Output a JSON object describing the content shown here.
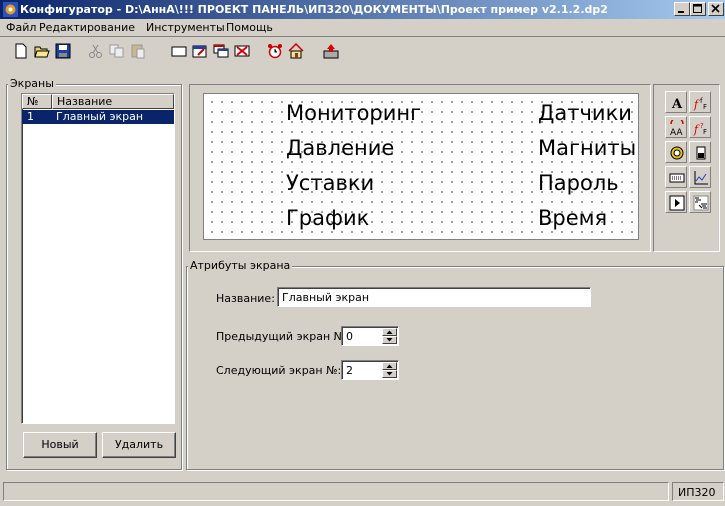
{
  "window": {
    "title": "Конфигуратор - D:\\АннА\\!!! ПРОЕКТ ПАНЕЛЬ\\ИП320\\ДОКУМЕНТЫ\\Проект пример v2.1.2.dp2"
  },
  "menu": [
    "Файл",
    "Редактирование",
    "Инструменты",
    "Помощь"
  ],
  "screens_panel": {
    "legend": "Экраны",
    "columns": [
      "№",
      "Название"
    ],
    "rows": [
      {
        "num": "1",
        "name": "Главный экран"
      }
    ],
    "new_button": "Новый",
    "delete_button": "Удалить"
  },
  "canvas": {
    "rows": [
      {
        "left": "Мониторинг",
        "right": "Датчики"
      },
      {
        "left": "Давление",
        "right": "Магниты"
      },
      {
        "left": "Уставки",
        "right": "Пароль"
      },
      {
        "left": "График",
        "right": "Время"
      }
    ]
  },
  "attributes": {
    "legend": "Атрибуты экрана",
    "name_label": "Название:",
    "name_value": "Главный экран",
    "prev_label": "Предыдущий экран №:",
    "prev_value": "0",
    "next_label": "Следующий экран №:",
    "next_value": "2"
  },
  "palette": {
    "text_glyph": "A"
  },
  "status": {
    "right_text": "ИП320"
  },
  "colors": {
    "titlebar_start": "#0a246a",
    "selection": "#0a246a",
    "face": "#d4d0c8"
  }
}
